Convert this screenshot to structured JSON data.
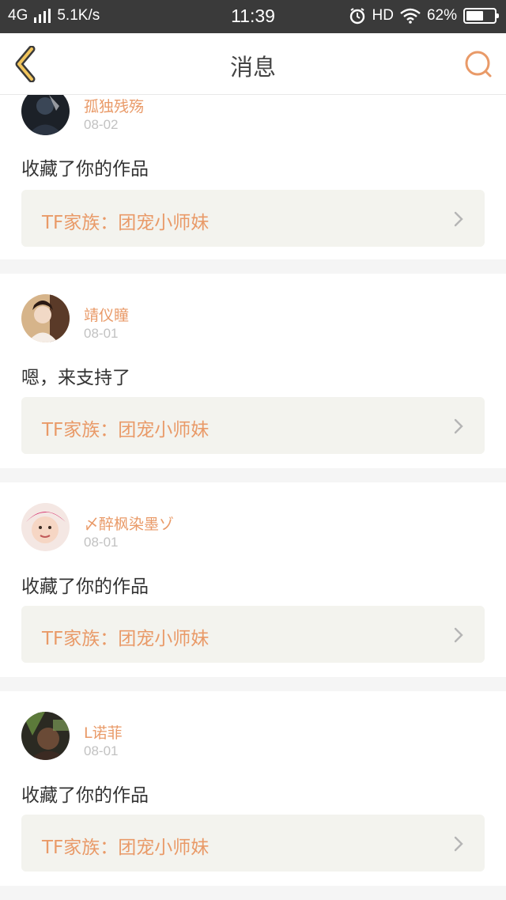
{
  "status_bar": {
    "network": "4G",
    "speed": "5.1K/s",
    "time": "11:39",
    "hd": "HD",
    "battery_percent": "62%",
    "battery_level": 0.62,
    "icons": [
      "signal-icon",
      "alarm-icon",
      "wifi-icon",
      "battery-icon"
    ]
  },
  "header": {
    "title": "消息",
    "back_icon": "chevron-left-icon",
    "search_icon": "search-icon",
    "accent": "#e99a68"
  },
  "messages": [
    {
      "username": "孤独残殇",
      "date": "08-02",
      "text": "收藏了你的作品",
      "work": "TF家族：团宠小师妹"
    },
    {
      "username": "靖仪瞳",
      "date": "08-01",
      "text": "嗯，来支持了",
      "work": "TF家族：团宠小师妹"
    },
    {
      "username": "〆醉枫染墨ゾ",
      "date": "08-01",
      "text": "收藏了你的作品",
      "work": "TF家族：团宠小师妹"
    },
    {
      "username": "L诺菲",
      "date": "08-01",
      "text": "收藏了你的作品",
      "work": "TF家族：团宠小师妹"
    }
  ]
}
